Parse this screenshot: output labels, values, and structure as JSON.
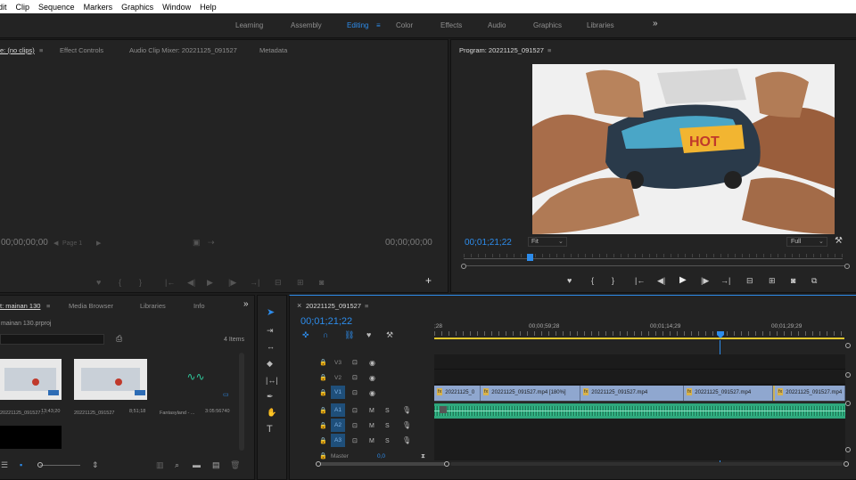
{
  "menu": [
    "dit",
    "Clip",
    "Sequence",
    "Markers",
    "Graphics",
    "Window",
    "Help"
  ],
  "workspaces": [
    "Learning",
    "Assembly",
    "Editing",
    "Color",
    "Effects",
    "Audio",
    "Graphics",
    "Libraries"
  ],
  "workspace_active": "Editing",
  "workspace_more": "»",
  "source_panel": {
    "tabs": [
      "e: (no clips)",
      "Effect Controls",
      "Audio Clip Mixer: 20221125_091527",
      "Metadata"
    ],
    "tc_left": "00;00;00;00",
    "tc_right": "00;00;00;00",
    "page": "Page 1"
  },
  "program_panel": {
    "title": "Program: 20221125_091527",
    "timecode": "00;01;21;22",
    "fit": "Fit",
    "quality": "Full"
  },
  "project_panel": {
    "tabs": [
      "t: mainan 130",
      "Media Browser",
      "Libraries",
      "Info"
    ],
    "file": "mainan 130.prproj",
    "items_count": "4 Items",
    "clips": [
      {
        "name": "20221125_091527...",
        "duration": "13;43;20"
      },
      {
        "name": "20221125_091527",
        "duration": "8;51;18"
      },
      {
        "name": "Fantasyland - ...",
        "duration": "3:05:56740"
      }
    ]
  },
  "timeline": {
    "tab": "20221125_091527",
    "timecode": "00;01;21;22",
    "ruler": [
      ";28",
      "00;00;59;28",
      "00;01;14;29",
      "00;01;29;29"
    ],
    "video_tracks": [
      "V3",
      "V2",
      "V1"
    ],
    "audio_tracks": [
      "A1",
      "A2",
      "A3"
    ],
    "master_label": "Master",
    "master_value": "0,0",
    "clips": [
      "20221125_0",
      "20221125_091527.mp4 [180%]",
      "20221125_091527.mp4",
      "20221125_091527.mp4",
      "20221125_091527.mp4"
    ]
  },
  "colors": {
    "accent": "#2d8ceb",
    "video_clip": "#8fa7cf",
    "audio_clip": "#2fa87d"
  }
}
